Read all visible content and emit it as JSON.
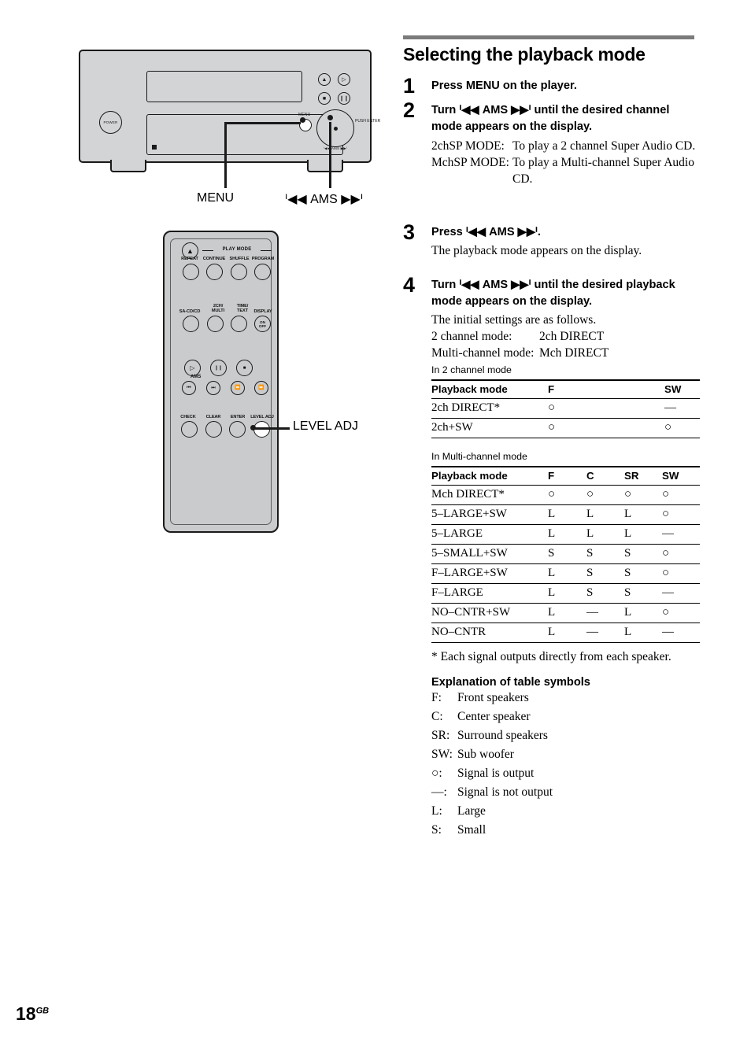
{
  "page": {
    "number": "18",
    "region_code": "GB"
  },
  "section": {
    "title": "Selecting the playback mode"
  },
  "steps": [
    {
      "num": "1",
      "title": "Press MENU on the player."
    },
    {
      "num": "2",
      "title": "Turn ᑊ◀◀ AMS ▶▶ᑊ until the desired channel mode appears on the display.",
      "modes": [
        {
          "key": "2chSP MODE:",
          "value": "To play a 2 channel Super Audio CD."
        },
        {
          "key": "MchSP MODE:",
          "value": "To play a Multi-channel Super Audio CD."
        }
      ]
    },
    {
      "num": "3",
      "title": "Press ᑊ◀◀ AMS ▶▶ᑊ.",
      "sub": "The playback mode appears on the display."
    },
    {
      "num": "4",
      "title": "Turn ᑊ◀◀ AMS ▶▶ᑊ until the desired playback mode appears on the display.",
      "sub": "The initial settings are as follows.",
      "initial": [
        {
          "key": "2 channel mode:",
          "value": "2ch DIRECT"
        },
        {
          "key": "Multi-channel mode:",
          "value": "Mch DIRECT"
        }
      ]
    }
  ],
  "table_2ch": {
    "caption": "In 2 channel mode",
    "columns": [
      "Playback mode",
      "F",
      "SW"
    ],
    "rows": [
      {
        "mode": "2ch DIRECT*",
        "f": "○",
        "sw": "—"
      },
      {
        "mode": "2ch+SW",
        "f": "○",
        "sw": "○"
      }
    ]
  },
  "table_multi": {
    "caption": "In Multi-channel mode",
    "columns": [
      "Playback mode",
      "F",
      "C",
      "SR",
      "SW"
    ],
    "rows": [
      {
        "mode": "Mch DIRECT*",
        "f": "○",
        "c": "○",
        "sr": "○",
        "sw": "○"
      },
      {
        "mode": "5–LARGE+SW",
        "f": "L",
        "c": "L",
        "sr": "L",
        "sw": "○"
      },
      {
        "mode": "5–LARGE",
        "f": "L",
        "c": "L",
        "sr": "L",
        "sw": "—"
      },
      {
        "mode": "5–SMALL+SW",
        "f": "S",
        "c": "S",
        "sr": "S",
        "sw": "○"
      },
      {
        "mode": "F–LARGE+SW",
        "f": "L",
        "c": "S",
        "sr": "S",
        "sw": "○"
      },
      {
        "mode": "F–LARGE",
        "f": "L",
        "c": "S",
        "sr": "S",
        "sw": "—"
      },
      {
        "mode": "NO–CNTR+SW",
        "f": "L",
        "c": "—",
        "sr": "L",
        "sw": "○"
      },
      {
        "mode": "NO–CNTR",
        "f": "L",
        "c": "—",
        "sr": "L",
        "sw": "—"
      }
    ]
  },
  "footnote": "* Each signal outputs directly from each speaker.",
  "explanation": {
    "title": "Explanation of table symbols",
    "items": [
      {
        "key": "F:",
        "value": "Front speakers"
      },
      {
        "key": "C:",
        "value": "Center speaker"
      },
      {
        "key": "SR:",
        "value": "Surround speakers"
      },
      {
        "key": "SW:",
        "value": "Sub woofer"
      },
      {
        "key": "○:",
        "value": "Signal is output"
      },
      {
        "key": "—:",
        "value": "Signal is not output"
      },
      {
        "key": "L:",
        "value": "Large"
      },
      {
        "key": "S:",
        "value": "Small"
      }
    ]
  },
  "illustration": {
    "player": {
      "power_label": "POWER",
      "menu_label": "MENU",
      "push_enter": "PUSH ENTER",
      "knob_sub": "ᑊ◀◀ AMS ▶▶ᑊ",
      "buttons": [
        "eject",
        "play",
        "stop",
        "pause"
      ],
      "callouts": {
        "menu": "MENU",
        "ams": "ᑊ◀◀ AMS ▶▶ᑊ"
      }
    },
    "remote": {
      "play_mode_label": "PLAY MODE",
      "row1": [
        "REPEAT",
        "CONTINUE",
        "SHUFFLE",
        "PROGRAM"
      ],
      "row2": [
        "SA-CD/CD",
        "2CH/ MULTI",
        "TIME/ TEXT",
        "DISPLAY"
      ],
      "row2_raw": {
        "sacd": "SA-CD/CD",
        "multi_top": "2CH/",
        "multi_bottom": "MULTI",
        "time_top": "TIME/",
        "time_bottom": "TEXT",
        "display": "DISPLAY",
        "on": "ON",
        "off": "OFF"
      },
      "ams_tag": "AMS",
      "row4": [
        "CHECK",
        "CLEAR",
        "ENTER",
        "LEVEL ADJ"
      ],
      "callout": "LEVEL ADJ"
    }
  },
  "colors": {
    "chassis": "#d2d4d5",
    "remote": "#c9cbcc",
    "rule": "#7b7b7b",
    "ink": "#000000"
  }
}
